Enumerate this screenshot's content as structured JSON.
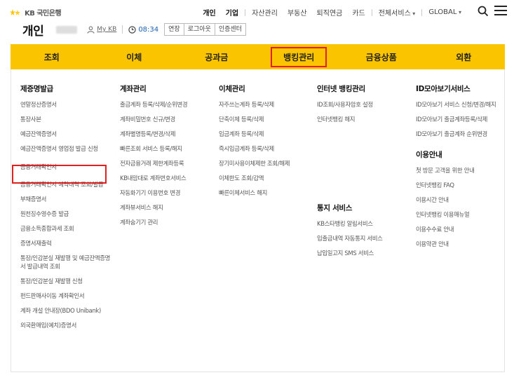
{
  "brand": {
    "name": "KB 국민은행"
  },
  "topnav": {
    "items": [
      "개인",
      "기업",
      "자산관리",
      "부동산",
      "퇴직연금",
      "카드",
      "전체서비스",
      "GLOBAL"
    ]
  },
  "header": {
    "title": "개인",
    "mykb": "My KB",
    "timer": "08:34",
    "extend": "연장",
    "logout": "로그아웃",
    "cert_center": "인증센터"
  },
  "mainnav": {
    "tabs": [
      "조회",
      "이체",
      "공과금",
      "뱅킹관리",
      "금융상품",
      "외환"
    ],
    "active_index": 3
  },
  "menu": {
    "col1": {
      "title": "제증명발급",
      "items": [
        "연말정산증명서",
        "통장사본",
        "예금잔액증명서",
        "예금잔액증명서 영업점 발급 신청",
        "금융거래확인서",
        "금융거래확인서 예약내역 조회/발급",
        "부채증명서",
        "원천징수영수증 발급",
        "금융소득종합과세 조회",
        "증명서재출력",
        "통장/인감분실 재발행 및 예금잔액증명서 발급내역 조회",
        "통장/인감분실 재발행 신청",
        "펀드판매사이동 계좌확인서",
        "계좌 개설 안내장(BDO Unibank)",
        "외국환매입(예치)증명서"
      ]
    },
    "col2": {
      "title": "계좌관리",
      "items": [
        "출금계좌 등록/삭제/순위변경",
        "계좌비밀번호 신규/변경",
        "계좌별명등록/변경/삭제",
        "빠른조회 서비스 등록/해지",
        "전자금융거래 제한계좌등록",
        "KB내맘대로 계좌번호서비스",
        "자동화기기 이용번호 변경",
        "계좌뷰서비스 해지",
        "계좌숨기기 관리"
      ]
    },
    "col3": {
      "title": "이체관리",
      "items": [
        "자주쓰는계좌 등록/삭제",
        "단축이체 등록/삭제",
        "입금계좌 등록/삭제",
        "즉시입금계좌 등록/삭제",
        "장기미사용이체제한 조회/해제",
        "이체한도 조회/감액",
        "빠른이체서비스 해지"
      ]
    },
    "col4": {
      "title": "인터넷 뱅킹관리",
      "items": [
        "ID조회/사용자암호 설정",
        "인터넷뱅킹 해지"
      ],
      "sub_title": "통지 서비스",
      "sub_items": [
        "KB스타뱅킹 알림서비스",
        "입출금내역 자동통지 서비스",
        "납입일고지 SMS 서비스"
      ]
    },
    "col5": {
      "title": "ID모아보기서비스",
      "items": [
        "ID모아보기 서비스 신청/변경/해지",
        "ID모아보기 출금계좌등록/삭제",
        "ID모아보기 출금계좌 순위변경"
      ],
      "sub_title": "이용안내",
      "sub_items": [
        "첫 방문 고객을 위한 안내",
        "인터넷뱅킹 FAQ",
        "이용시간 안내",
        "인터넷뱅킹 이용매뉴얼",
        "이용수수료 안내",
        "이용약관 안내"
      ]
    }
  },
  "colors": {
    "accent": "#fbc400",
    "highlight": "#e0201f",
    "link": "#1a5fb4"
  }
}
